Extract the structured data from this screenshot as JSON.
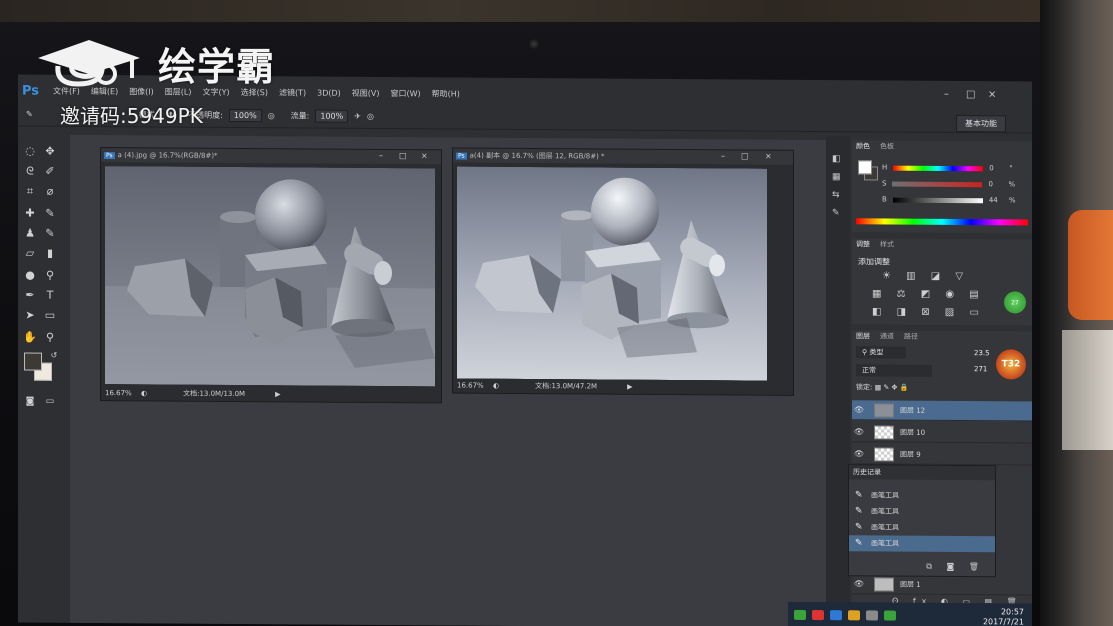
{
  "watermark": {
    "brand": "绘学霸",
    "invite": "邀请码:5949PK"
  },
  "app": {
    "logo": "Ps",
    "menu": [
      "文件(F)",
      "编辑(E)",
      "图像(I)",
      "图层(L)",
      "文字(Y)",
      "选择(S)",
      "滤镜(T)",
      "3D(D)",
      "视图(V)",
      "窗口(W)",
      "帮助(H)"
    ],
    "window_controls": [
      "–",
      "□",
      "×"
    ]
  },
  "options": {
    "mode_label": "模式:",
    "opacity_label": "不透明度:",
    "opacity_value": "100%",
    "flow_label": "流量:",
    "flow_value": "100%",
    "workspace": "基本功能"
  },
  "documents": [
    {
      "title": "a (4).jpg @ 16.7%(RGB/8#)*",
      "zoom": "16.67%",
      "doc_info": "文档:13.0M/13.0M"
    },
    {
      "title": "a(4) 副本 @ 16.7% (图层 12, RGB/8#) *",
      "zoom": "16.67%",
      "doc_info": "文档:13.0M/47.2M"
    }
  ],
  "color_panel": {
    "tabs": [
      "颜色",
      "色板"
    ],
    "sliders": [
      {
        "label": "H",
        "value": "0",
        "unit": "°"
      },
      {
        "label": "S",
        "value": "0",
        "unit": "%"
      },
      {
        "label": "B",
        "value": "44",
        "unit": "%"
      }
    ]
  },
  "adjust_panel": {
    "tabs": [
      "调整",
      "样式"
    ],
    "title": "添加调整",
    "row1": "☀ ▥ ◪ ▽",
    "row2": "▦ ⚖ ◩ ◉ ▤",
    "row3": "◧ ◨ ⊠ ▨ ▭"
  },
  "layers_panel": {
    "tabs": [
      "图层",
      "通道",
      "路径"
    ],
    "filter": "类型",
    "blend": "正常",
    "lock_label": "锁定:",
    "layers": [
      {
        "name": "图层 12",
        "selected": true
      },
      {
        "name": "图层 10",
        "selected": false
      },
      {
        "name": "图层 9",
        "selected": false
      },
      {
        "name": "图层 1",
        "selected": false
      }
    ]
  },
  "history_panel": {
    "title": "历史记录",
    "items": [
      "画笔工具",
      "画笔工具",
      "画笔工具",
      "画笔工具"
    ]
  },
  "overlay_widget": {
    "badge": "27",
    "speed1": "23.5",
    "speed2": "271",
    "logo_text": "T32"
  },
  "taskbar": {
    "time": "20:57",
    "date": "2017/7/21"
  }
}
